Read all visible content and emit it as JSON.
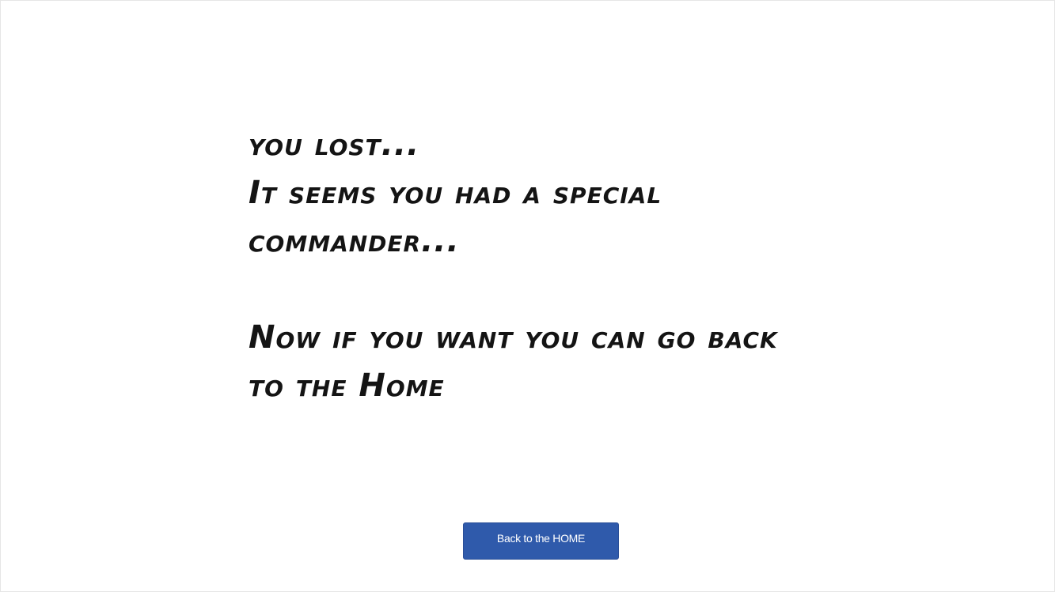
{
  "message": {
    "lines_top": [
      "you lost...",
      "It seems you had a special",
      "commander..."
    ],
    "lines_bottom": [
      "Now if you want you can go back",
      "to the Home"
    ]
  },
  "actions": {
    "home_button_label": "Back to the HOME"
  },
  "colors": {
    "button_background": "#2f5aab",
    "button_text": "#ffffff",
    "message_text": "#141414",
    "page_background": "#ffffff"
  }
}
